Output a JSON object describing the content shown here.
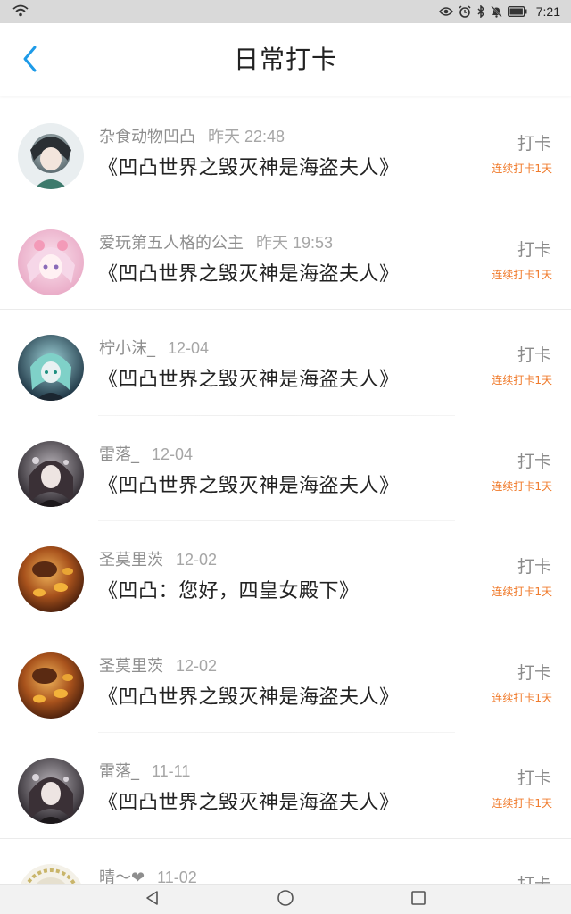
{
  "status_bar": {
    "time": "7:21"
  },
  "header": {
    "title": "日常打卡"
  },
  "checkins": [
    {
      "username": "杂食动物凹凸",
      "time": "昨天 22:48",
      "content": "《凹凸世界之毁灭神是海盗夫人》",
      "button": "打卡",
      "streak": "连续打卡1天"
    },
    {
      "username": "爱玩第五人格的公主",
      "time": "昨天 19:53",
      "content": "《凹凸世界之毁灭神是海盗夫人》",
      "button": "打卡",
      "streak": "连续打卡1天"
    },
    {
      "username": "柠小沫_",
      "time": "12-04",
      "content": "《凹凸世界之毁灭神是海盗夫人》",
      "button": "打卡",
      "streak": "连续打卡1天"
    },
    {
      "username": "雷落_",
      "time": "12-04",
      "content": "《凹凸世界之毁灭神是海盗夫人》",
      "button": "打卡",
      "streak": "连续打卡1天"
    },
    {
      "username": "圣莫里茨",
      "time": "12-02",
      "content": "《凹凸：您好，四皇女殿下》",
      "button": "打卡",
      "streak": "连续打卡1天"
    },
    {
      "username": "圣莫里茨",
      "time": "12-02",
      "content": "《凹凸世界之毁灭神是海盗夫人》",
      "button": "打卡",
      "streak": "连续打卡1天"
    },
    {
      "username": "雷落_",
      "time": "11-11",
      "content": "《凹凸世界之毁灭神是海盗夫人》",
      "button": "打卡",
      "streak": "连续打卡1天"
    },
    {
      "username": "晴～❤",
      "time": "11-02",
      "content": "",
      "button": "打卡",
      "streak": ""
    }
  ],
  "icons": {
    "back": "chevron-left-icon",
    "sys_back": "triangle-back-icon",
    "sys_home": "circle-home-icon",
    "sys_recent": "square-recent-icon"
  },
  "colors": {
    "accent": "#1e9be8",
    "streak": "#f07b2c"
  }
}
